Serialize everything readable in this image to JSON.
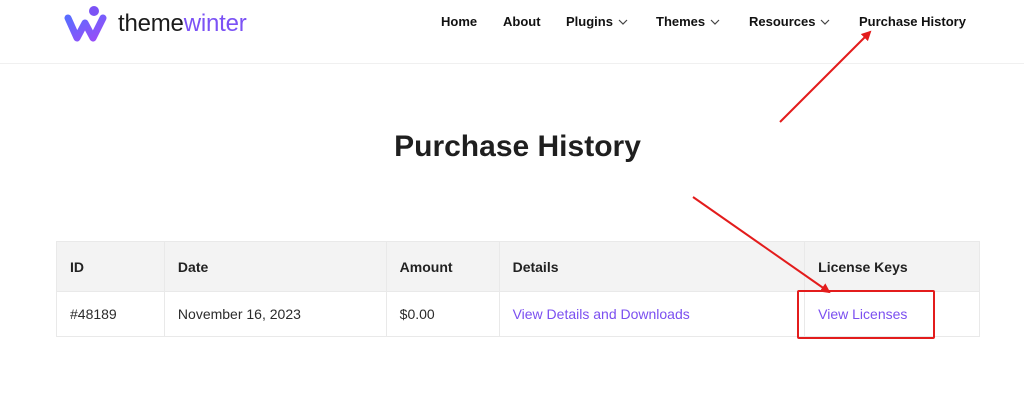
{
  "brand": {
    "name_part1": "theme",
    "name_part2": "winter",
    "accent": "#7b52f5"
  },
  "nav": {
    "items": [
      {
        "label": "Home"
      },
      {
        "label": "About"
      },
      {
        "label": "Plugins",
        "dropdown": true
      },
      {
        "label": "Themes",
        "dropdown": true
      },
      {
        "label": "Resources",
        "dropdown": true
      },
      {
        "label": "Purchase History"
      }
    ]
  },
  "page": {
    "title": "Purchase History"
  },
  "table": {
    "headers": [
      "ID",
      "Date",
      "Amount",
      "Details",
      "License Keys"
    ],
    "rows": [
      {
        "id": "#48189",
        "date": "November 16, 2023",
        "amount": "$0.00",
        "details": "View Details and Downloads",
        "license": "View Licenses"
      }
    ]
  },
  "annotation": {
    "color": "#e31c1c"
  }
}
